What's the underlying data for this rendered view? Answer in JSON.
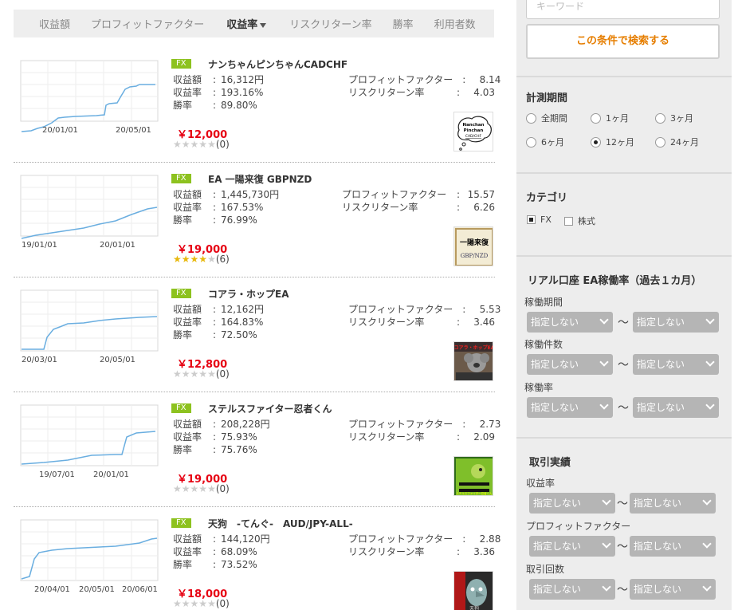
{
  "sort_tabs": [
    {
      "label": "収益額",
      "active": false
    },
    {
      "label": "プロフィットファクター",
      "active": false
    },
    {
      "label": "収益率",
      "active": true
    },
    {
      "label": "リスクリターン率",
      "active": false
    },
    {
      "label": "勝率",
      "active": false
    },
    {
      "label": "利用者数",
      "active": false
    }
  ],
  "stat_labels": {
    "profit": "収益額",
    "rate": "収益率",
    "win": "勝率",
    "pf": "プロフィットファクター",
    "rr": "リスクリターン率",
    "colon": ":"
  },
  "items": [
    {
      "badge": "FX",
      "name": "ナンちゃんピンちゃんCADCHF",
      "profit": "16,312円",
      "rate": "193.16%",
      "win": "89.80%",
      "pf": "8.14",
      "rr": "4.03",
      "price": "￥12,000",
      "stars": 0,
      "reviews": "(0)",
      "date_l": "20/01/01",
      "date_r": "20/05/01",
      "thumb": "Nanchan Pinchan CAD/CHF"
    },
    {
      "badge": "FX",
      "name": "EA 一陽来復 GBPNZD",
      "profit": "1,445,730円",
      "rate": "167.53%",
      "win": "76.99%",
      "pf": "15.57",
      "rr": "6.26",
      "price": "￥19,000",
      "stars": 4,
      "reviews": "(6)",
      "date_l": "19/01/01",
      "date_r": "20/01/01",
      "thumb": "一陽来復 GBP/NZD"
    },
    {
      "badge": "FX",
      "name": "コアラ・ホップEA",
      "profit": "12,162円",
      "rate": "164.83%",
      "win": "72.50%",
      "pf": "5.53",
      "rr": "3.46",
      "price": "￥12,800",
      "stars": 0,
      "reviews": "(0)",
      "date_l": "20/03/01",
      "date_r": "20/05/01",
      "thumb": "コアラ・ホップEA"
    },
    {
      "badge": "FX",
      "name": "ステルスファイター忍者くん",
      "profit": "208,228円",
      "rate": "75.93%",
      "win": "75.76%",
      "pf": "2.73",
      "rr": "2.09",
      "price": "￥19,000",
      "stars": 0,
      "reviews": "(0)",
      "date_l": "19/07/01",
      "date_r": "20/01/01",
      "thumb": "ステルスファイター忍者くん"
    },
    {
      "badge": "FX",
      "name": "天狗　-てんぐ-　AUD/JPY-ALL-",
      "profit": "144,120円",
      "rate": "68.09%",
      "win": "73.52%",
      "pf": "2.88",
      "rr": "3.36",
      "price": "￥18,000",
      "stars": 0,
      "reviews": "(0)",
      "date_l": "20/04/01",
      "date_m": "20/05/01",
      "date_r": "20/06/01",
      "thumb": "天狗"
    }
  ],
  "sidebar": {
    "keyword_placeholder": "キーワード",
    "search_button": "この条件で検索する",
    "period_title": "計測期間",
    "periods": [
      "全期間",
      "1ヶ月",
      "3ヶ月",
      "6ヶ月",
      "12ヶ月",
      "24ヶ月"
    ],
    "period_selected": "12ヶ月",
    "category_title": "カテゴリ",
    "categories": [
      "FX",
      "株式"
    ],
    "category_selected": "FX",
    "real_title": "リアル口座 EA稼働率（過去１カ月）",
    "real_fields": [
      "稼働期間",
      "稼働件数",
      "稼働率"
    ],
    "trade_title": "取引実績",
    "trade_fields": [
      "収益率",
      "プロフィットファクター",
      "取引回数"
    ],
    "select_default": "指定しない",
    "tilde": "～"
  },
  "colors": {
    "accent_orange": "#e67e00",
    "price_red": "#e60012",
    "fx_green": "#8dc21f",
    "chart_line": "#6aaee0"
  }
}
